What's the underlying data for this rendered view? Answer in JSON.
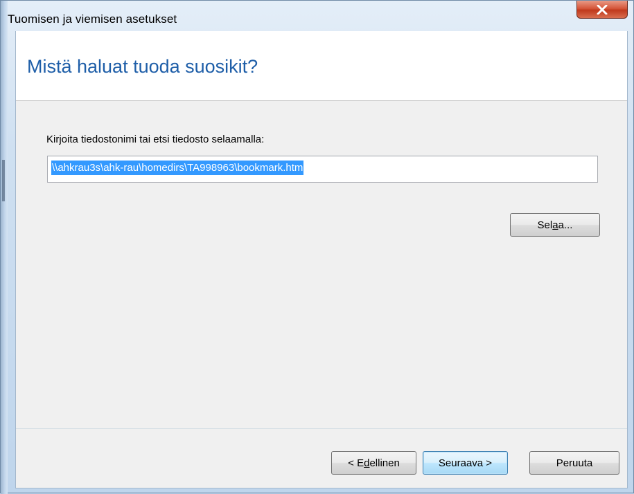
{
  "window": {
    "title": "Tuomisen ja viemisen asetukset",
    "close_icon": "close-x-icon"
  },
  "page": {
    "heading": "Mistä haluat tuoda suosikit?",
    "prompt": "Kirjoita tiedostonimi tai etsi tiedosto selaamalla:",
    "path_value": "\\\\ahkrau3s\\ahk-rau\\homedirs\\TA998963\\bookmark.htm"
  },
  "buttons": {
    "browse": {
      "pre": "Sel",
      "accel": "a",
      "post": "a..."
    },
    "back": {
      "pre": "< E",
      "accel": "d",
      "post": "ellinen"
    },
    "next": {
      "label": "Seuraava >"
    },
    "cancel": {
      "label": "Peruuta"
    }
  },
  "colors": {
    "heading": "#1e5ea8",
    "selection": "#3399ff",
    "close_button": "#c7452a"
  }
}
